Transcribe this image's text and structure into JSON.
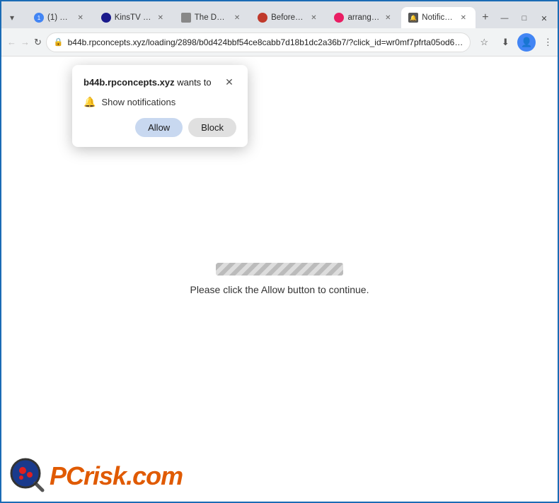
{
  "tabs": [
    {
      "id": "new",
      "label": "(1) New",
      "active": false,
      "favicon": "new"
    },
    {
      "id": "kinstv",
      "label": "KinsTV C…",
      "active": false,
      "favicon": "kins"
    },
    {
      "id": "theday",
      "label": "The Day…",
      "active": false,
      "favicon": "theday"
    },
    {
      "id": "before",
      "label": "Before d…",
      "active": false,
      "favicon": "before"
    },
    {
      "id": "arranged",
      "label": "arrange…",
      "active": false,
      "favicon": "arranged"
    },
    {
      "id": "notif",
      "label": "Notificat…",
      "active": true,
      "favicon": "notif"
    }
  ],
  "address": "b44b.rpconcepts.xyz/loading/2898/b0d424bbf54ce8cabb7d18b1dc2a36b7/?click_id=wr0mf7pfrta05od6…",
  "popup": {
    "site": "b44b.rpconcepts.xyz",
    "wants_to": " wants to",
    "notification_label": "Show notifications",
    "allow_label": "Allow",
    "block_label": "Block"
  },
  "page": {
    "progress_text": "Please click the Allow button to continue."
  },
  "logo": {
    "pc_text": "PC",
    "risk_text": "risk.com"
  },
  "window_controls": {
    "minimize": "—",
    "maximize": "□",
    "close": "✕"
  }
}
